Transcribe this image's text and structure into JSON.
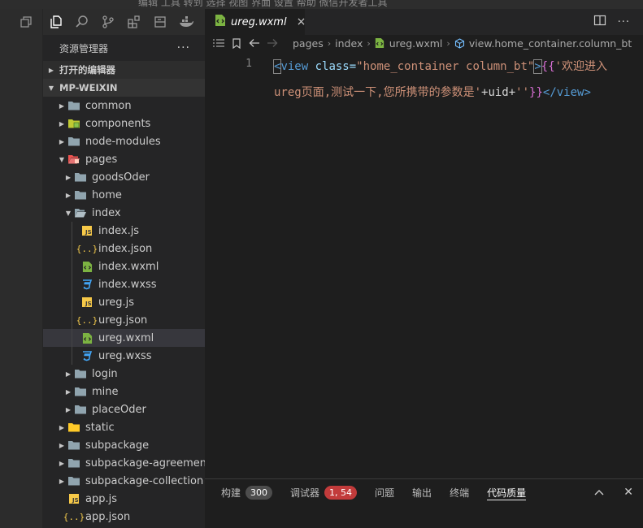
{
  "topbar": {
    "ghost_text": "编辑   工具   转到   选择   视图   界面   设置   帮助   微信开发者工具"
  },
  "explorer": {
    "title": "资源管理器",
    "more": "···",
    "open_editors": "打开的编辑器",
    "project": "MP-WEIXIN"
  },
  "tree": [
    {
      "label": "common",
      "depth": 0,
      "type": "folder",
      "arrow": "closed"
    },
    {
      "label": "components",
      "depth": 0,
      "type": "folder-components",
      "arrow": "closed"
    },
    {
      "label": "node-modules",
      "depth": 0,
      "type": "folder",
      "arrow": "closed"
    },
    {
      "label": "pages",
      "depth": 0,
      "type": "folder-pages",
      "arrow": "open"
    },
    {
      "label": "goodsOder",
      "depth": 1,
      "type": "folder",
      "arrow": "closed"
    },
    {
      "label": "home",
      "depth": 1,
      "type": "folder",
      "arrow": "closed"
    },
    {
      "label": "index",
      "depth": 1,
      "type": "folder-open",
      "arrow": "open"
    },
    {
      "label": "index.js",
      "depth": 2,
      "type": "js"
    },
    {
      "label": "index.json",
      "depth": 2,
      "type": "json"
    },
    {
      "label": "index.wxml",
      "depth": 2,
      "type": "wxml"
    },
    {
      "label": "index.wxss",
      "depth": 2,
      "type": "wxss"
    },
    {
      "label": "ureg.js",
      "depth": 2,
      "type": "js"
    },
    {
      "label": "ureg.json",
      "depth": 2,
      "type": "json"
    },
    {
      "label": "ureg.wxml",
      "depth": 2,
      "type": "wxml",
      "selected": true
    },
    {
      "label": "ureg.wxss",
      "depth": 2,
      "type": "wxss"
    },
    {
      "label": "login",
      "depth": 1,
      "type": "folder",
      "arrow": "closed"
    },
    {
      "label": "mine",
      "depth": 1,
      "type": "folder",
      "arrow": "closed"
    },
    {
      "label": "placeOder",
      "depth": 1,
      "type": "folder",
      "arrow": "closed"
    },
    {
      "label": "static",
      "depth": 0,
      "type": "folder-static",
      "arrow": "closed"
    },
    {
      "label": "subpackage",
      "depth": 0,
      "type": "folder",
      "arrow": "closed"
    },
    {
      "label": "subpackage-agreement",
      "depth": 0,
      "type": "folder",
      "arrow": "closed"
    },
    {
      "label": "subpackage-collection",
      "depth": 0,
      "type": "folder",
      "arrow": "closed"
    },
    {
      "label": "app.js",
      "depth": 0,
      "type": "js"
    },
    {
      "label": "app.json",
      "depth": 0,
      "type": "json"
    }
  ],
  "tab": {
    "label": "ureg.wxml",
    "close": "×"
  },
  "breadcrumb": {
    "items": [
      "pages",
      "index",
      "ureg.wxml",
      "view.home_container.column_bt"
    ]
  },
  "code": {
    "line_number": "1",
    "line1": {
      "open_lt": "<",
      "tag": "view",
      "attr": " class=",
      "value": "\"home_container column_bt\"",
      "close_gt": ">",
      "open_brace": "{{",
      "string_start": "'欢迎进入"
    },
    "line2": {
      "string_cont": "ureg页面,测试一下,您所携带的参数是'",
      "plus1": "+uid+",
      "empty_str": "''",
      "close_brace": "}}",
      "end_tag": "</view>"
    }
  },
  "panel": {
    "tabs": [
      {
        "label": "构建",
        "badge": "300",
        "badge_type": "neutral"
      },
      {
        "label": "调试器",
        "badge": "1, 54",
        "badge_type": "error"
      },
      {
        "label": "问题"
      },
      {
        "label": "输出"
      },
      {
        "label": "终端"
      },
      {
        "label": "代码质量",
        "active": true
      }
    ],
    "maximize": "︿",
    "close": "✕"
  },
  "colors": {
    "accent_error": "#c23b3b",
    "tag": "#569cd6",
    "attr": "#9cdcfe",
    "string": "#ce9178",
    "brace": "#da70d6"
  }
}
